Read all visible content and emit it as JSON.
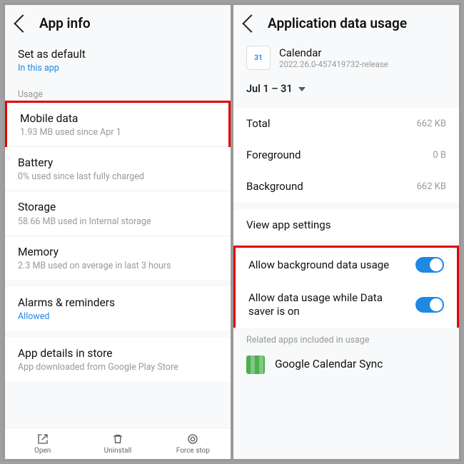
{
  "left": {
    "title": "App info",
    "setDefault": {
      "label": "Set as default",
      "sub": "In this app"
    },
    "usageHeader": "Usage",
    "rows": [
      {
        "label": "Mobile data",
        "sub": "1.93 MB used since Apr 1",
        "hl": true
      },
      {
        "label": "Battery",
        "sub": "0% used since last fully charged"
      },
      {
        "label": "Storage",
        "sub": "58.66 MB used in Internal storage"
      },
      {
        "label": "Memory",
        "sub": "2.3 MB used on average in last 3 hours"
      }
    ],
    "alarms": {
      "label": "Alarms & reminders",
      "sub": "Allowed"
    },
    "details": {
      "label": "App details in store",
      "sub": "App downloaded from Google Play Store"
    },
    "actions": [
      "Open",
      "Uninstall",
      "Force stop"
    ]
  },
  "right": {
    "title": "Application data usage",
    "app": {
      "name": "Calendar",
      "version": "2022.26.0-457419732-release",
      "icon": "31"
    },
    "range": "Jul 1 – 31",
    "kv": [
      {
        "k": "Total",
        "v": "662 KB"
      },
      {
        "k": "Foreground",
        "v": "0 B"
      },
      {
        "k": "Background",
        "v": "662 KB"
      }
    ],
    "viewSettings": "View app settings",
    "toggles": [
      {
        "k": "Allow background data usage"
      },
      {
        "k": "Allow data usage while Data saver is on"
      }
    ],
    "relatedHdr": "Related apps included in usage",
    "related": "Google Calendar Sync"
  }
}
